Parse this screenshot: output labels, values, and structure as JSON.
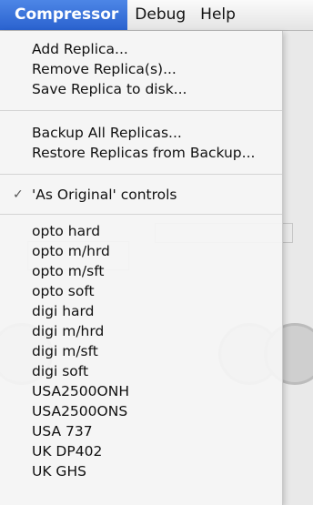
{
  "menubar": {
    "items": [
      {
        "label": "Compressor"
      },
      {
        "label": "Debug"
      },
      {
        "label": "Help"
      }
    ]
  },
  "menu": {
    "replica_items": [
      {
        "label": "Add Replica..."
      },
      {
        "label": "Remove Replica(s)..."
      },
      {
        "label": "Save Replica to disk..."
      }
    ],
    "backup_items": [
      {
        "label": "Backup All Replicas..."
      },
      {
        "label": "Restore Replicas from Backup..."
      }
    ],
    "as_original": {
      "label": "'As Original' controls",
      "checked": true,
      "check_glyph": "✓"
    },
    "preset_items": [
      {
        "label": "opto hard"
      },
      {
        "label": "opto m/hrd"
      },
      {
        "label": "opto m/sft"
      },
      {
        "label": "opto soft"
      },
      {
        "label": "digi hard"
      },
      {
        "label": "digi m/hrd"
      },
      {
        "label": "digi m/sft"
      },
      {
        "label": "digi soft"
      },
      {
        "label": "USA2500ONH"
      },
      {
        "label": "USA2500ONS"
      },
      {
        "label": "USA 737"
      },
      {
        "label": "UK DP402"
      },
      {
        "label": "UK GHS"
      }
    ]
  },
  "colors": {
    "menubar_active_bg": "#2a62cf",
    "menu_bg": "#f6f6f6"
  }
}
